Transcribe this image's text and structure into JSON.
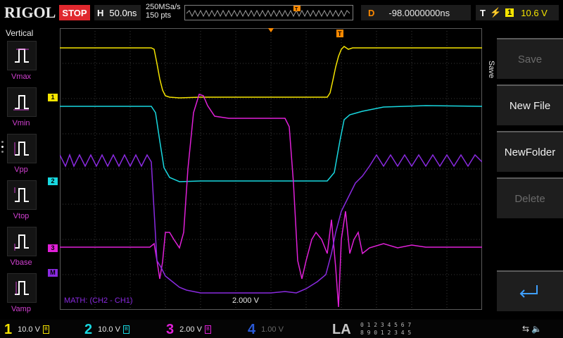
{
  "topbar": {
    "logo": "RIGOL",
    "run_state": "STOP",
    "horizontal_label": "H",
    "horizontal_scale": "50.0ns",
    "sample_rate": "250MSa/s",
    "points": "150 pts",
    "delay_label": "D",
    "delay_value": "-98.0000000ns",
    "trigger_label": "T",
    "trigger_edge": "⚡",
    "trigger_channel": "1",
    "trigger_level": "10.6 V"
  },
  "left_menu": {
    "title": "Vertical",
    "items": [
      {
        "label": "Vmax"
      },
      {
        "label": "Vmin"
      },
      {
        "label": "Vpp"
      },
      {
        "label": "Vtop"
      },
      {
        "label": "Vbase"
      },
      {
        "label": "Vamp"
      }
    ]
  },
  "right_menu": {
    "tab_label": "Save",
    "buttons": [
      {
        "label": "Save",
        "enabled": false
      },
      {
        "label": "New File",
        "enabled": true
      },
      {
        "label": "NewFolder",
        "enabled": true
      },
      {
        "label": "Delete",
        "enabled": false
      },
      {
        "label": "",
        "enabled": true
      }
    ]
  },
  "math": {
    "label": "MATH: (CH2 - CH1)",
    "scale": "2.000 V"
  },
  "channel_markers": [
    "1",
    "2",
    "3",
    "M"
  ],
  "bottombar": {
    "ch1": {
      "num": "1",
      "scale": "10.0 V",
      "color": "#f5e400"
    },
    "ch2": {
      "num": "2",
      "scale": "10.0 V",
      "color": "#18d8e0"
    },
    "ch3": {
      "num": "3",
      "scale": "2.00 V",
      "color": "#e020d8"
    },
    "ch4": {
      "num": "4",
      "scale": "1.00 V",
      "color": "#2a5ad8"
    },
    "la": "LA",
    "la_digits_top": "0 1 2 3   4 5 6 7",
    "la_digits_bottom": "8 9 0 1   2 3 4 5",
    "usb": "⇆ 🔈"
  },
  "colors": {
    "ch1": "#f5e400",
    "ch2": "#18d8e0",
    "ch3": "#e020d8",
    "math": "#8a2ae0",
    "trigger_marker": "#ff8a00"
  }
}
